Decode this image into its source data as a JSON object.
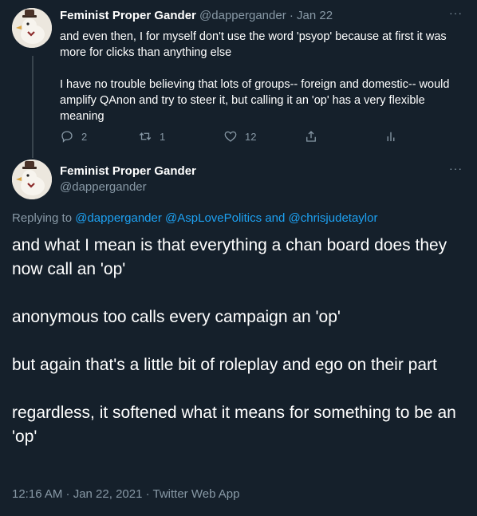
{
  "tweet1": {
    "author_name": "Feminist Proper Gander",
    "handle": "@dappergander",
    "separator": "·",
    "date": "Jan 22",
    "more_label": "···",
    "paragraphs": [
      "and even then, I for myself don't use the word 'psyop' because at first it was more for clicks than anything else",
      "I have no trouble believing that lots of groups-- foreign and domestic-- would amplify QAnon and try to steer it, but calling it an 'op' has a very flexible meaning"
    ],
    "actions": {
      "reply_count": "2",
      "retweet_count": "1",
      "like_count": "12"
    }
  },
  "tweet2": {
    "author_name": "Feminist Proper Gander",
    "handle": "@dappergander",
    "more_label": "···",
    "replying_prefix": "Replying to ",
    "replying_handles": [
      "@dappergander",
      "@AspLovePolitics"
    ],
    "replying_and": " and ",
    "replying_last": "@chrisjudetaylor",
    "paragraphs": [
      "and what I mean is that everything a chan board does they now call an 'op'",
      "anonymous too calls every campaign an 'op'",
      "but again that's a little bit of roleplay and ego on their part",
      "regardless, it softened what it means for something to be an 'op'"
    ],
    "timestamp": "12:16 AM · Jan 22, 2021 · Twitter Web App"
  },
  "icons": [
    "reply-icon",
    "retweet-icon",
    "like-icon",
    "share-icon",
    "analytics-icon",
    "avatar-duck"
  ],
  "colors": {
    "background": "#15202b",
    "text": "#ffffff",
    "muted": "#8899a6",
    "link": "#1da1f2",
    "thread_line": "#38444d"
  }
}
